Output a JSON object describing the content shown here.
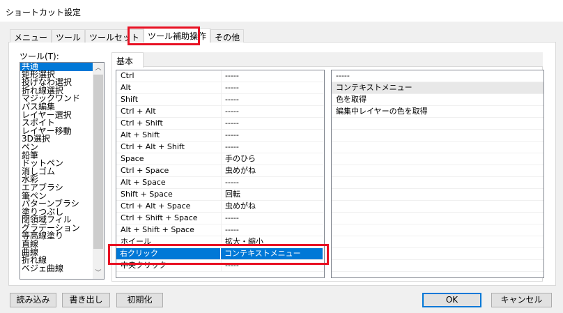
{
  "title": "ショートカット設定",
  "tabs": [
    "メニュー",
    "ツール",
    "ツールセット",
    "ツール補助操作",
    "その他"
  ],
  "tool_label": "ツール(T):",
  "tools": [
    "共通",
    "矩形選択",
    "投げなわ選択",
    "折れ線選択",
    "マジックワンド",
    "パス編集",
    "レイヤー選択",
    "スポイト",
    "レイヤー移動",
    "3D選択",
    "ペン",
    "鉛筆",
    "ドットペン",
    "消しゴム",
    "水彩",
    "エアブラシ",
    "筆ペン",
    "パターンブラシ",
    "塗りつぶし",
    "閉領域フィル",
    "グラデーション",
    "等高線塗り",
    "直線",
    "曲線",
    "折れ線",
    "ベジェ曲線"
  ],
  "subtab": "基本",
  "rows": [
    {
      "key": "Ctrl",
      "action": "-----"
    },
    {
      "key": "Alt",
      "action": "-----"
    },
    {
      "key": "Shift",
      "action": "-----"
    },
    {
      "key": "Ctrl + Alt",
      "action": "-----"
    },
    {
      "key": "Ctrl + Shift",
      "action": "-----"
    },
    {
      "key": "Alt + Shift",
      "action": "-----"
    },
    {
      "key": "Ctrl + Alt + Shift",
      "action": "-----"
    },
    {
      "key": "Space",
      "action": "手のひら"
    },
    {
      "key": "Ctrl + Space",
      "action": "虫めがね"
    },
    {
      "key": "Alt + Space",
      "action": "-----"
    },
    {
      "key": "Shift + Space",
      "action": "回転"
    },
    {
      "key": "Ctrl + Alt + Space",
      "action": "虫めがね"
    },
    {
      "key": "Ctrl + Shift + Space",
      "action": "-----"
    },
    {
      "key": "Alt + Shift + Space",
      "action": "-----"
    },
    {
      "key": "ホイール",
      "action": "拡大・縮小"
    },
    {
      "key": "右クリック",
      "action": "コンテキストメニュー"
    },
    {
      "key": "中央クリック",
      "action": "-----"
    }
  ],
  "options": [
    "-----",
    "コンテキストメニュー",
    "色を取得",
    "編集中レイヤーの色を取得"
  ],
  "buttons": {
    "load": "読み込み",
    "export": "書き出し",
    "reset": "初期化",
    "ok": "OK",
    "cancel": "キャンセル"
  }
}
